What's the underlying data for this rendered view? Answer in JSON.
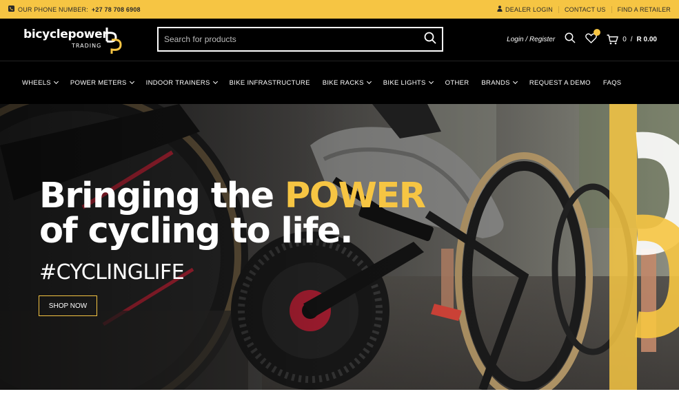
{
  "topbar": {
    "phone_label": "OUR PHONE NUMBER:",
    "phone_number": "+27 78 708 6908",
    "links": [
      "DEALER LOGIN",
      "CONTACT US",
      "FIND A RETAILER"
    ]
  },
  "header": {
    "logo_word_1": "bicycle",
    "logo_word_2": "power",
    "logo_sub": "TRADING",
    "search_placeholder": "Search for products",
    "login_label": "Login / Register",
    "cart_count": "0",
    "cart_separator": "/",
    "cart_total": "R 0.00"
  },
  "nav": {
    "items": [
      {
        "label": "WHEELS",
        "dropdown": true
      },
      {
        "label": "POWER METERS",
        "dropdown": true
      },
      {
        "label": "INDOOR TRAINERS",
        "dropdown": true
      },
      {
        "label": "BIKE INFRASTRUCTURE",
        "dropdown": false
      },
      {
        "label": "BIKE RACKS",
        "dropdown": true
      },
      {
        "label": "BIKE LIGHTS",
        "dropdown": true
      },
      {
        "label": "OTHER",
        "dropdown": false
      },
      {
        "label": "BRANDS",
        "dropdown": true
      },
      {
        "label": "REQUEST A DEMO",
        "dropdown": false
      },
      {
        "label": "FAQS",
        "dropdown": false
      }
    ]
  },
  "hero": {
    "headline_1": "Bringing the",
    "headline_accent": "POWER",
    "headline_2": "of cycling to life.",
    "tagline": "#CYCLINGLIFE",
    "button_label": "SHOP NOW"
  },
  "icons": {
    "phone": "phone-icon",
    "user": "user-icon",
    "search": "search-icon",
    "wishlist": "heart-icon",
    "cart": "cart-icon"
  },
  "colors": {
    "accent": "#f6c543",
    "header_bg": "#000000",
    "text_light": "#ffffff"
  }
}
